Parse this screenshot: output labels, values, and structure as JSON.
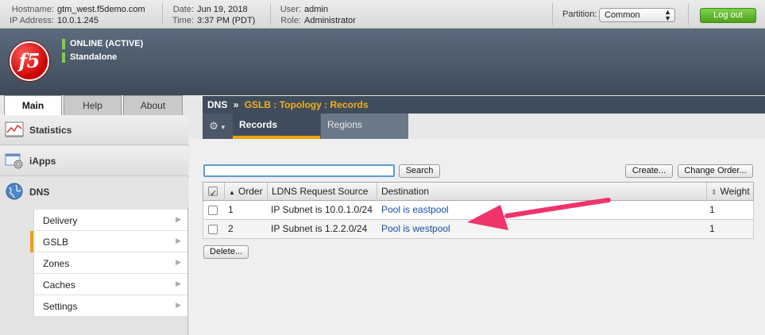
{
  "topbar": {
    "hostname_label": "Hostname:",
    "hostname": "gtm_west.f5demo.com",
    "ip_label": "IP Address:",
    "ip": "10.0.1.245",
    "date_label": "Date:",
    "date": "Jun 19, 2018",
    "time_label": "Time:",
    "time": "3:37 PM (PDT)",
    "user_label": "User:",
    "user": "admin",
    "role_label": "Role:",
    "role": "Administrator",
    "partition_label": "Partition:",
    "partition_value": "Common",
    "logout_label": "Log out"
  },
  "banner": {
    "logo_text": "f5",
    "status_primary": "ONLINE (ACTIVE)",
    "status_secondary": "Standalone"
  },
  "left_tabs": [
    {
      "label": "Main",
      "active": true
    },
    {
      "label": "Help",
      "active": false
    },
    {
      "label": "About",
      "active": false
    }
  ],
  "sidebar": {
    "sections": [
      {
        "label": "Statistics",
        "icon": "statistics-icon"
      },
      {
        "label": "iApps",
        "icon": "iapps-icon"
      },
      {
        "label": "DNS",
        "icon": "globe-icon"
      }
    ],
    "dns_items": [
      {
        "label": "Delivery",
        "selected": false
      },
      {
        "label": "GSLB",
        "selected": true
      },
      {
        "label": "Zones",
        "selected": false
      },
      {
        "label": "Caches",
        "selected": false
      },
      {
        "label": "Settings",
        "selected": false
      }
    ]
  },
  "header": {
    "root": "DNS",
    "separator": "»",
    "crumb": "GSLB : Topology : Records"
  },
  "tabs": {
    "gear_icon": "gear-icon",
    "items": [
      {
        "label": "Records",
        "active": true
      },
      {
        "label": "Regions",
        "active": false
      }
    ]
  },
  "toolbar": {
    "search_value": "",
    "search_button": "Search",
    "create_button": "Create...",
    "change_order_button": "Change Order..."
  },
  "table": {
    "columns": [
      "Order",
      "LDNS Request Source",
      "Destination",
      "Weight"
    ],
    "sort_indicator": "▲",
    "rows": [
      {
        "order": "1",
        "source": "IP Subnet is 10.0.1.0/24",
        "destination": "Pool is eastpool",
        "weight": "1"
      },
      {
        "order": "2",
        "source": "IP Subnet is 1.2.2.0/24",
        "destination": "Pool is westpool",
        "weight": "1"
      }
    ]
  },
  "delete_button": "Delete...",
  "colors": {
    "accent": "#f0a30a",
    "header_bg": "#3f4c5c",
    "link": "#1a4fa6",
    "logout_green": "#5bb12a",
    "annotation_arrow": "#f0336b"
  }
}
